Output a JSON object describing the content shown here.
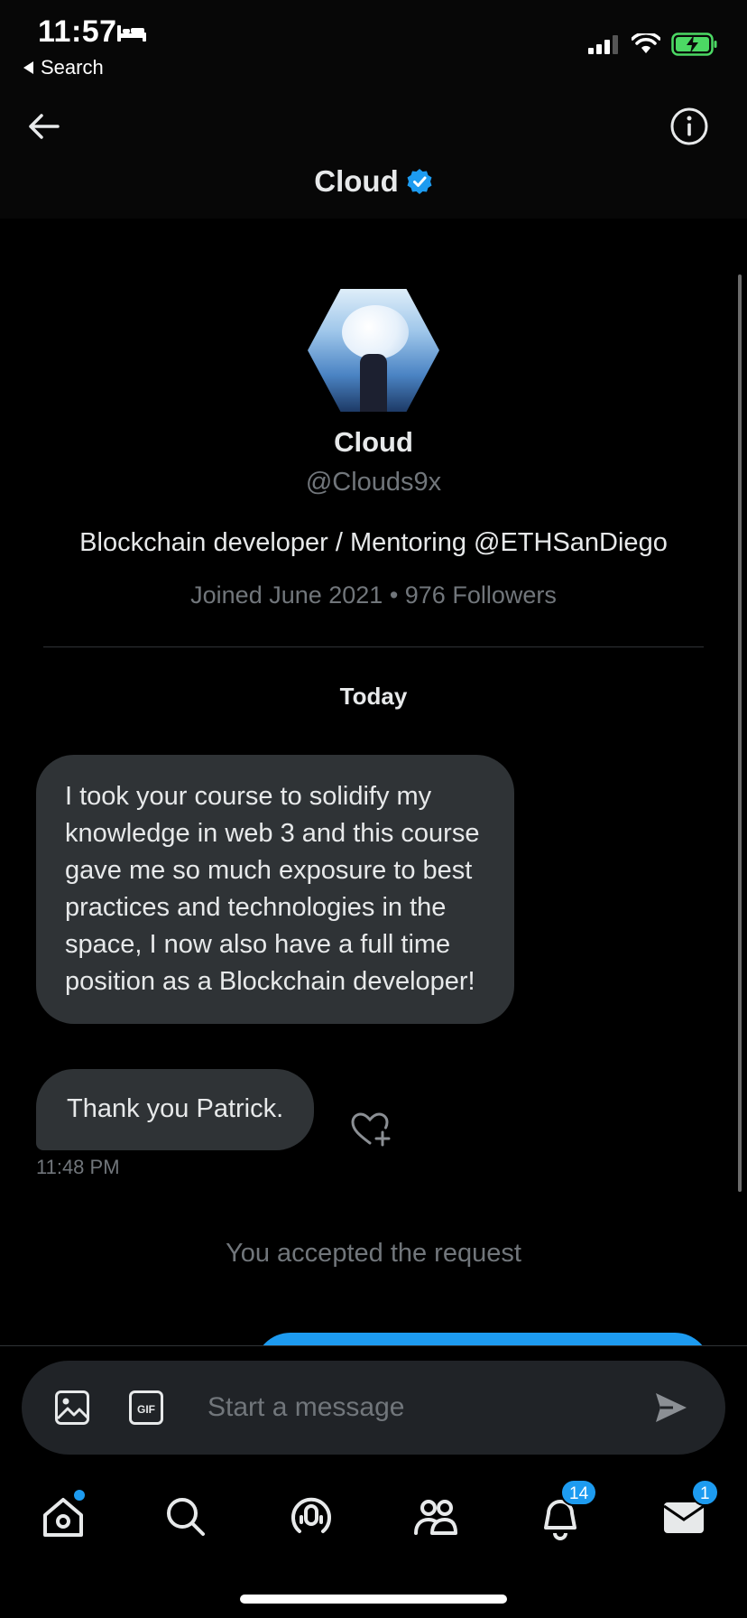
{
  "status_bar": {
    "time": "11:57",
    "back_app_label": "Search"
  },
  "header": {
    "title": "Cloud"
  },
  "profile": {
    "name": "Cloud",
    "handle": "@Clouds9x",
    "bio": "Blockchain developer / Mentoring @ETHSanDiego",
    "meta": "Joined June 2021 • 976 Followers"
  },
  "conversation": {
    "day_label": "Today",
    "messages": [
      {
        "text": "I took your course to solidify my knowledge in web 3 and this course gave me so much exposure to best practices and technologies in the space, I now also have a full time position as a Blockchain developer!"
      },
      {
        "text": "Thank you Patrick."
      }
    ],
    "timestamp": "11:48 PM",
    "system_note": "You accepted the request"
  },
  "composer": {
    "placeholder": "Start a message"
  },
  "tabbar": {
    "items": [
      {
        "icon": "home-icon"
      },
      {
        "icon": "search-icon"
      },
      {
        "icon": "spaces-icon"
      },
      {
        "icon": "communities-icon"
      },
      {
        "icon": "notifications-icon",
        "badge": "14"
      },
      {
        "icon": "messages-icon",
        "badge": "1"
      }
    ]
  },
  "colors": {
    "accent": "#1d9bf0",
    "bubble": "#2f3336",
    "muted": "#71767b",
    "background": "#000000",
    "battery": "#4cd964"
  }
}
